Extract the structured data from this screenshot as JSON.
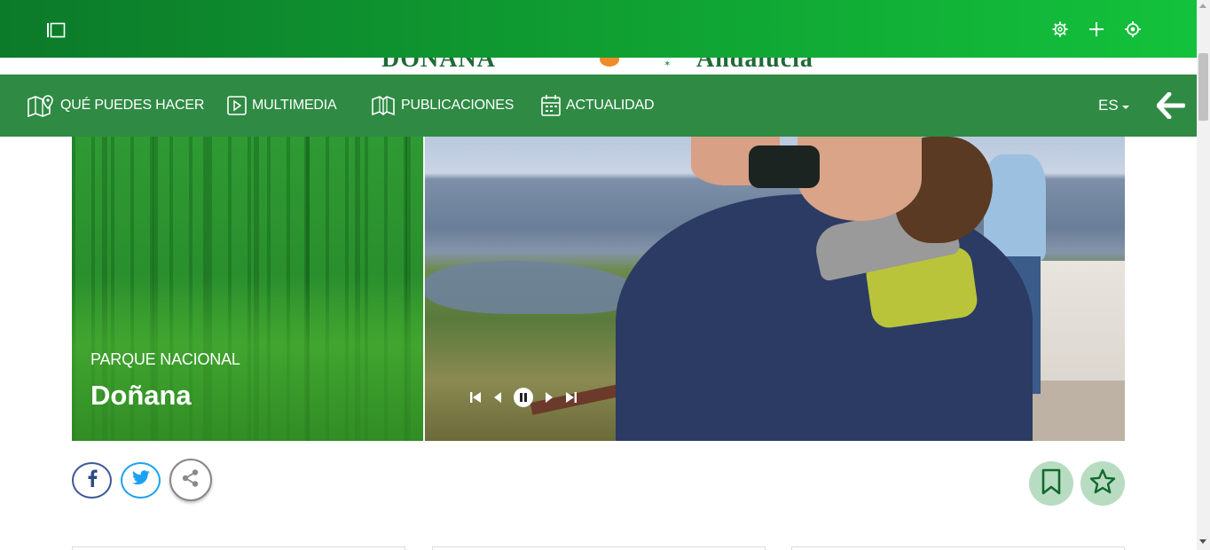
{
  "topbar": {
    "icons": [
      "sidebar-toggle-icon",
      "gear-icon",
      "plus-icon",
      "location-target-icon"
    ]
  },
  "logo": {
    "left_text": "DOÑANA",
    "right_text": "Andalucía"
  },
  "nav": {
    "items": [
      {
        "label": "QUÉ PUEDES HACER",
        "icon": "map-pin-icon"
      },
      {
        "label": "MULTIMEDIA",
        "icon": "play-icon"
      },
      {
        "label": "PUBLICACIONES",
        "icon": "book-icon"
      },
      {
        "label": "ACTUALIDAD",
        "icon": "calendar-icon"
      }
    ],
    "language": "ES"
  },
  "hero": {
    "subtitle": "PARQUE NACIONAL",
    "title": "Doñana",
    "slider_controls": [
      "first-icon",
      "prev-icon",
      "pause-icon",
      "next-icon",
      "last-icon"
    ]
  },
  "share": {
    "buttons": [
      "facebook-icon",
      "twitter-icon",
      "share-icon"
    ]
  },
  "actions": {
    "buttons": [
      "bookmark-icon",
      "star-icon"
    ]
  },
  "colors": {
    "topbar_start": "#0c7a2a",
    "topbar_end": "#13c23c",
    "nav_bg": "#2f8a44",
    "facebook": "#3b5998",
    "twitter": "#1da1f2",
    "action_bg": "#b8dcc2",
    "action_icon": "#0f6a2c"
  }
}
